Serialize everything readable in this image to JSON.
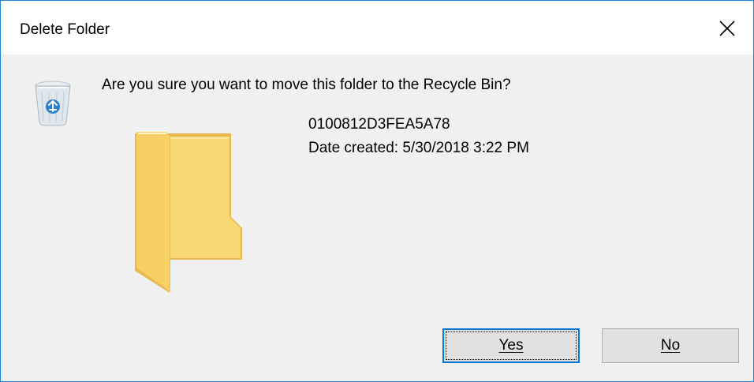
{
  "dialog": {
    "title": "Delete Folder",
    "close_icon": "close-icon",
    "message": "Are you sure you want to move this folder to the Recycle Bin?",
    "recycle_icon": "recycle-bin-icon",
    "folder_icon": "folder-icon",
    "item": {
      "name": "0100812D3FEA5A78",
      "date_created": "Date created: 5/30/2018 3:22 PM"
    },
    "buttons": {
      "yes": "Yes",
      "no": "No"
    }
  },
  "colors": {
    "window_border": "#1883d7",
    "dialog_background": "#f0f0f0",
    "titlebar_background": "#ffffff",
    "default_button_border": "#0078d7",
    "button_background": "#e1e1e1",
    "folder_yellow": "#f8d775"
  }
}
